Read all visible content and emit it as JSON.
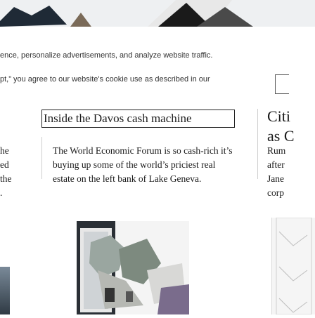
{
  "cookie_banner": {
    "line1": "ence, personalize advertisements, and analyze website traffic.",
    "line2": "pt,” you agree to our website's cookie use as described in our"
  },
  "center_article": {
    "headline": "Inside the Davos cash machine",
    "summary_lines": [
      "The World Economic Forum is so cash-rich it’s",
      "buying up some of the world’s priciest real",
      "estate on the left bank of Lake Geneva."
    ]
  },
  "left_article": {
    "fragments": [
      "he",
      "ed",
      "the",
      "."
    ]
  },
  "right_article": {
    "headline_lines": [
      "Citi",
      "as C"
    ],
    "summary_lines": [
      "Rum",
      "after",
      "Jane",
      "corp"
    ]
  },
  "colors": {
    "text": "#1a1a1a",
    "divider": "#cfcfcf",
    "frame": "#222222"
  }
}
